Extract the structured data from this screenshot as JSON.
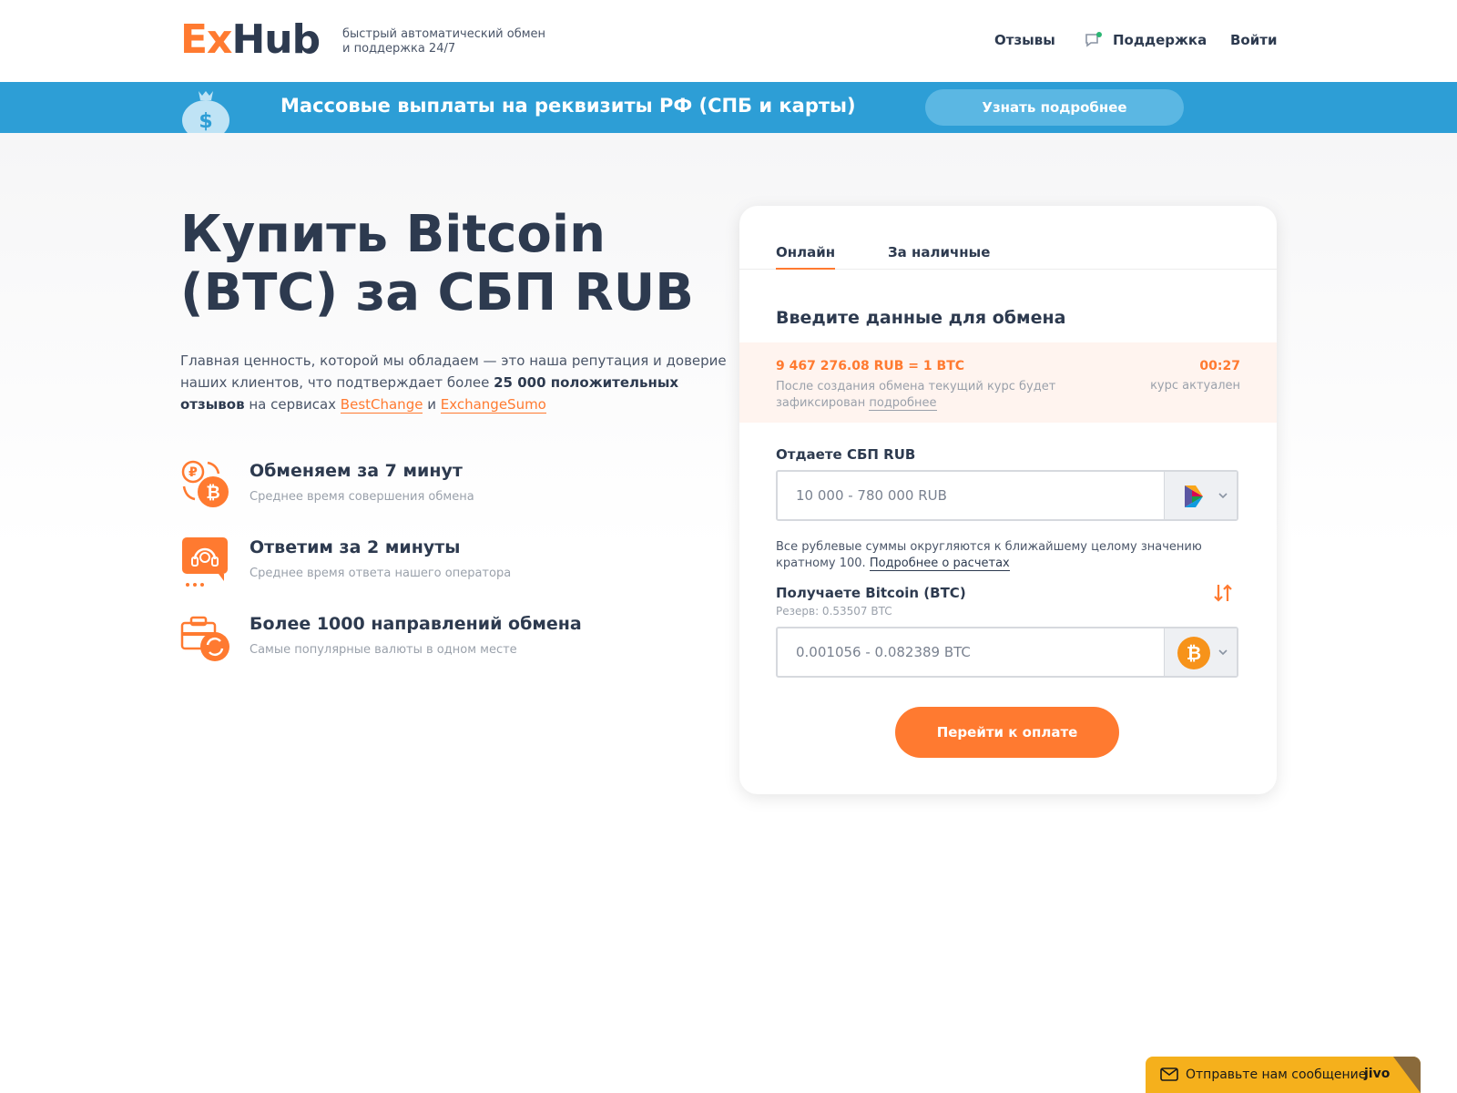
{
  "header": {
    "logo_ex": "Ex",
    "logo_hub": "Hub",
    "tagline_line1": "быстрый автоматический обмен",
    "tagline_line2": "и поддержка 24/7",
    "nav": {
      "reviews": "Отзывы",
      "support": "Поддержка",
      "login": "Войти"
    }
  },
  "banner": {
    "text": "Массовые выплаты на реквизиты РФ (СПБ и карты)",
    "button": "Узнать подробнее"
  },
  "hero": {
    "title_line1": "Купить Bitcoin",
    "title_line2": "(BTC) за СБП RUB",
    "desc_part1": "Главная ценность, которой мы обладаем — это наша репутация и доверие наших клиентов, что подтверждает более ",
    "desc_bold": "25 000 положительных отзывов",
    "desc_part2": " на сервисах ",
    "link1": "BestChange",
    "desc_and": " и ",
    "link2": "ExchangeSumo"
  },
  "features": [
    {
      "title": "Обменяем за 7 минут",
      "subtitle": "Среднее время совершения обмена",
      "icon": "exchange-coins-icon"
    },
    {
      "title": "Ответим за 2 минуты",
      "subtitle": "Среднее время ответа нашего оператора",
      "icon": "operator-headset-icon"
    },
    {
      "title": "Более 1000 направлений обмена",
      "subtitle": "Самые популярные валюты в одном месте",
      "icon": "directions-briefcase-icon"
    }
  ],
  "card": {
    "tabs": {
      "online": "Онлайн",
      "cash": "За наличные"
    },
    "heading": "Введите данные для обмена",
    "rate": {
      "value": "9 467 276.08 RUB = 1 BTC",
      "note_text": "После создания обмена текущий курс будет зафиксирован ",
      "note_link": "подробнее",
      "timer": "00:27",
      "timer_label": "курс актуален"
    },
    "give": {
      "label": "Отдаете СБП RUB",
      "placeholder": "10 000 - 780 000 RUB",
      "currency_icon": "sbp-icon"
    },
    "round_note_text": "Все рублевые суммы округляются к ближайшему целому значению кратному 100. ",
    "round_note_link": "Подробнее о расчетах",
    "get": {
      "label": "Получаете Bitcoin (BTC)",
      "reserve": "Резерв: 0.53507 BTC",
      "placeholder": "0.001056 - 0.082389 BTC",
      "currency_icon": "bitcoin-icon"
    },
    "pay_button": "Перейти к оплате"
  },
  "chat": {
    "text": "Отправьте нам сообщение",
    "brand": "jivo"
  },
  "colors": {
    "accent": "#ff7a30",
    "banner": "#2d9ed6",
    "text_dark": "#2d3a4f",
    "chat": "#f5b01c"
  }
}
